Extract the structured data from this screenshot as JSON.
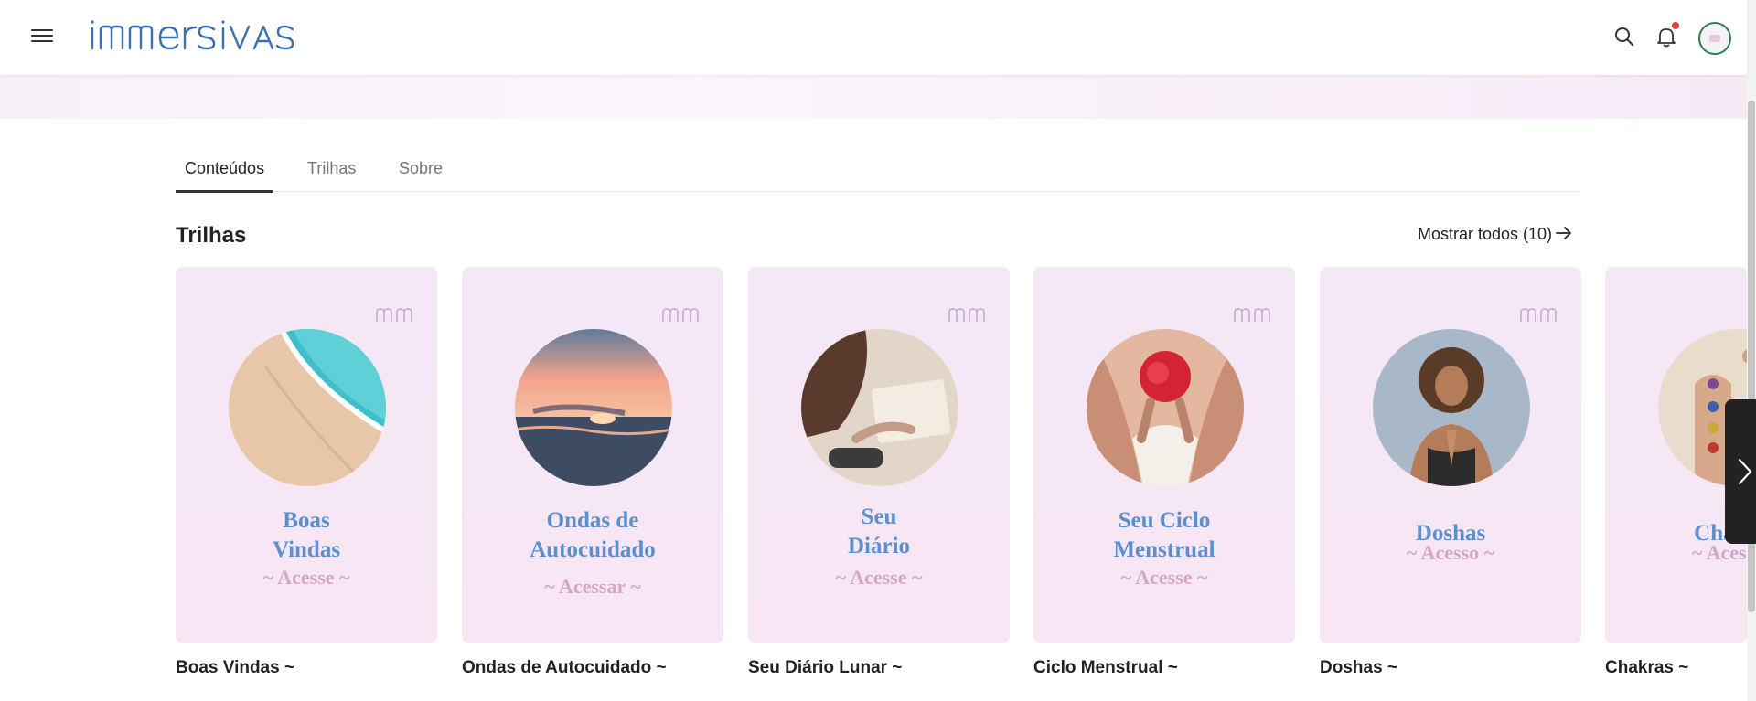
{
  "header": {
    "logo_text": "immersivas",
    "menu_icon": "hamburger-menu-icon",
    "search_icon": "search-icon",
    "bell_icon": "bell-icon",
    "notification_color": "#e53935",
    "avatar_border_color": "#2e7d4f"
  },
  "tabs": [
    {
      "label": "Conteúdos",
      "active": true
    },
    {
      "label": "Trilhas",
      "active": false
    },
    {
      "label": "Sobre",
      "active": false
    }
  ],
  "section": {
    "title": "Trilhas",
    "show_all_label": "Mostrar todos (10)",
    "show_all_icon": "arrow-right-icon"
  },
  "cards": [
    {
      "title_lines": [
        "Boas",
        "Vindas"
      ],
      "subtitle": "~ Acesse ~",
      "label": "Boas Vindas ~",
      "photo": "beach-waves"
    },
    {
      "title_lines": [
        "Ondas de",
        "Autocuidado"
      ],
      "subtitle": "~ Acessar ~",
      "label": "Ondas de Autocuidado ~",
      "photo": "sunset-sea"
    },
    {
      "title_lines": [
        "Seu",
        "Diário"
      ],
      "subtitle": "~ Acesse ~",
      "label": "Seu Diário Lunar ~",
      "photo": "woman-writing"
    },
    {
      "title_lines": [
        "Seu Ciclo",
        "Menstrual"
      ],
      "subtitle": "~ Acesse ~",
      "label": "Ciclo Menstrual ~",
      "photo": "red-flower"
    },
    {
      "title_lines": [
        "Doshas"
      ],
      "subtitle": "~ Acesso ~",
      "label": "Doshas ~",
      "photo": "woman-meditating"
    },
    {
      "title_lines": [
        "Chakras"
      ],
      "subtitle": "~ Acesso ~",
      "label": "Chakras ~",
      "photo": "hands-stones"
    }
  ],
  "colors": {
    "card_title": "#5b8fce",
    "card_subtitle": "#d4a6c6",
    "card_bg": "#f4e8f6"
  }
}
